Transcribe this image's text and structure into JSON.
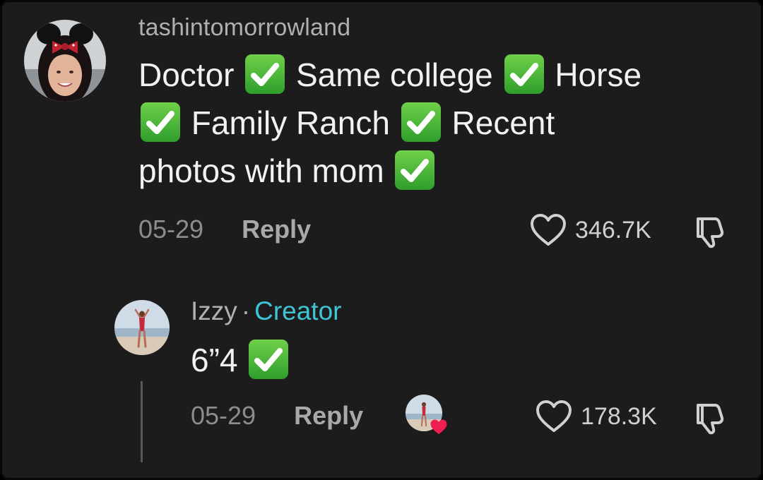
{
  "comment": {
    "username": "tashintomorrowland",
    "lines": [
      [
        "Doctor",
        "Same college",
        "Horse"
      ],
      [
        "Family Ranch",
        "Recent"
      ],
      [
        "photos with mom"
      ]
    ],
    "date": "05-29",
    "reply_label": "Reply",
    "likes": "346.7K"
  },
  "reply": {
    "username": "Izzy",
    "separator": "·",
    "badge": "Creator",
    "text": "6”4",
    "date": "05-29",
    "reply_label": "Reply",
    "likes": "178.3K"
  },
  "icons": {
    "check": "check-mark-button-emoji",
    "like": "heart-outline-icon",
    "dislike": "thumbs-down-outline-icon",
    "creator_liked": "creator-liked-heart-icon"
  },
  "colors": {
    "background": "#1c1c1c",
    "creator_badge": "#3fc4d6",
    "check_green": "#3bb33a",
    "liked_heart": "#ee1d52"
  }
}
